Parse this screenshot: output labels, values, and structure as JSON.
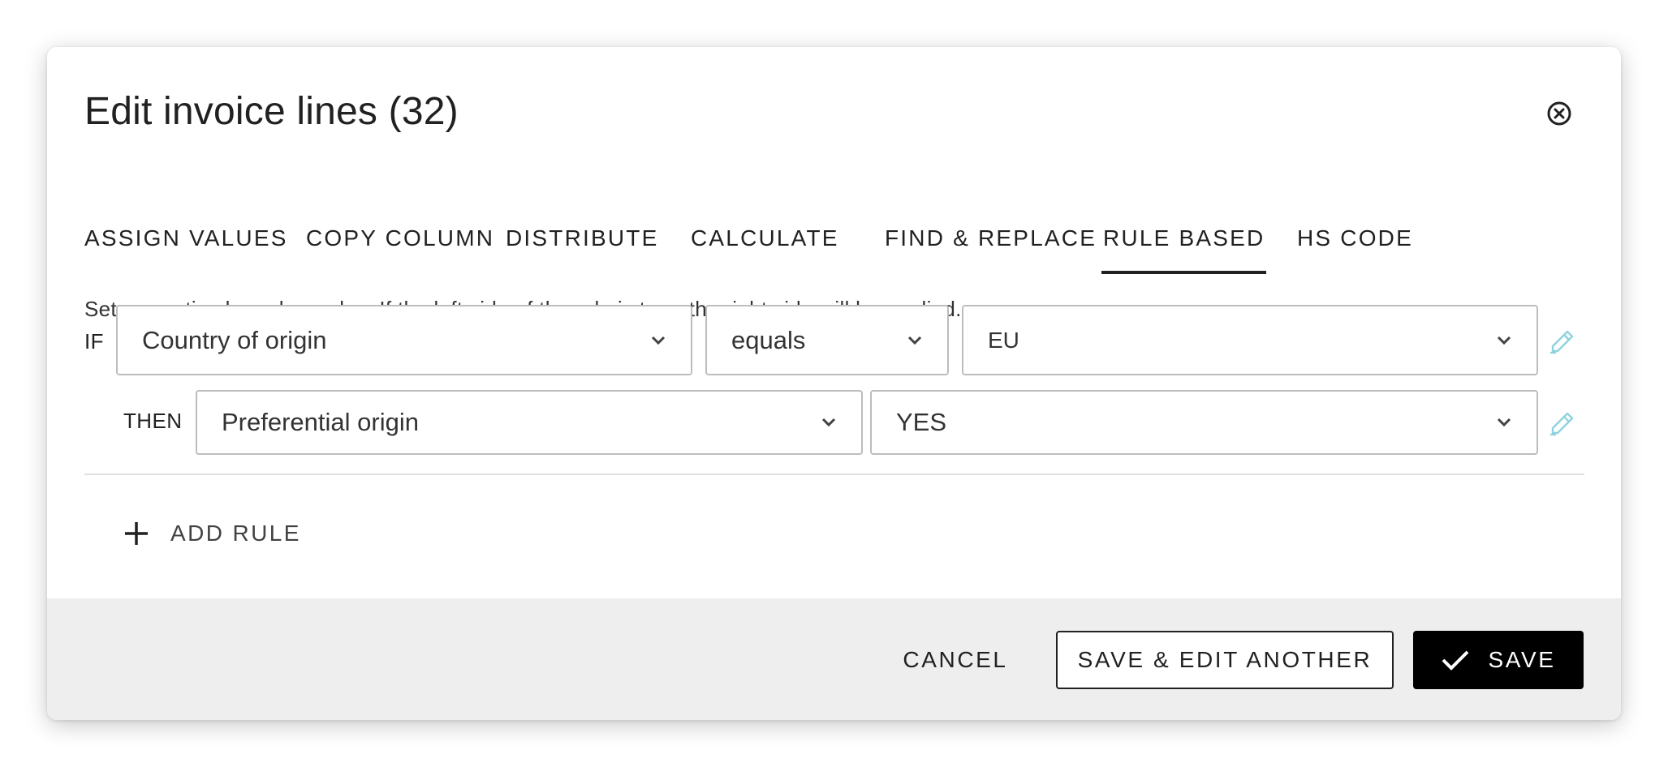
{
  "dialog": {
    "title": "Edit invoice lines (32)",
    "close_icon": "close-circle-icon"
  },
  "tabs": [
    {
      "label": "ASSIGN VALUES",
      "active": false
    },
    {
      "label": "COPY COLUMN",
      "active": false
    },
    {
      "label": "DISTRIBUTE",
      "active": false
    },
    {
      "label": "CALCULATE",
      "active": false
    },
    {
      "label": "FIND & REPLACE",
      "active": false
    },
    {
      "label": "RULE BASED",
      "active": true
    },
    {
      "label": "HS CODE",
      "active": false
    }
  ],
  "description": "Set properties based on rules. If the left side of the rule is true, the right side will be applied.",
  "rule": {
    "if_label": "IF",
    "condition_field": "Country of origin",
    "condition_operator": "equals",
    "condition_value": "EU",
    "then_label": "THEN",
    "target_field": "Preferential origin",
    "target_value": "YES"
  },
  "add_rule_label": "ADD RULE",
  "footer": {
    "cancel_label": "CANCEL",
    "save_another_label": "SAVE & EDIT ANOTHER",
    "save_label": "SAVE"
  },
  "colors": {
    "accent": "#000000",
    "edit_icon": "#8fd3de",
    "footer_bg": "#eeeeee",
    "border": "#bdbdbd"
  }
}
